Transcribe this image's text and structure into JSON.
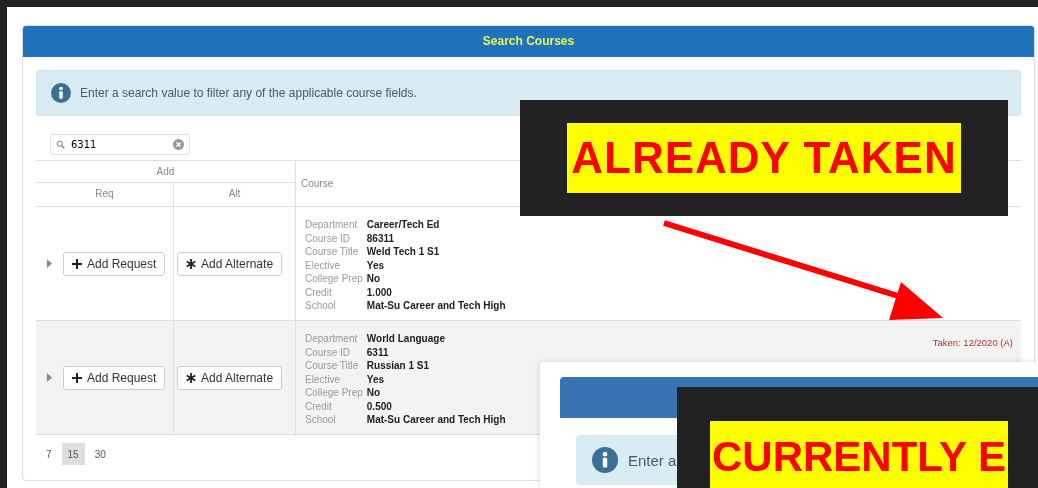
{
  "panel": {
    "title": "Search Courses",
    "info": "Enter a search value to filter any of the applicable course fields."
  },
  "search": {
    "value": "6311"
  },
  "table": {
    "group_header": "Add",
    "columns": [
      "Req",
      "Alt",
      "Course"
    ],
    "rows": [
      {
        "request_button": "Add Request",
        "alternate_button": "Add Alternate",
        "expanded": false,
        "fields": [
          {
            "label": "Department",
            "value": "Career/Tech Ed"
          },
          {
            "label": "Course ID",
            "value": "86311"
          },
          {
            "label": "Course Title",
            "value": "Weld Tech 1 S1"
          },
          {
            "label": "Elective",
            "value": "Yes"
          },
          {
            "label": "College Prep",
            "value": "No"
          },
          {
            "label": "Credit",
            "value": "1.000"
          },
          {
            "label": "School",
            "value": "Mat-Su Career and Tech High"
          }
        ]
      },
      {
        "request_button": "Add Request",
        "alternate_button": "Add Alternate",
        "expanded": false,
        "taken": "Taken: 12/2020 (A)",
        "fields": [
          {
            "label": "Department",
            "value": "World Language"
          },
          {
            "label": "Course ID",
            "value": "6311"
          },
          {
            "label": "Course Title",
            "value": "Russian 1 S1"
          },
          {
            "label": "Elective",
            "value": "Yes"
          },
          {
            "label": "College Prep",
            "value": "No"
          },
          {
            "label": "Credit",
            "value": "0.500"
          },
          {
            "label": "School",
            "value": "Mat-Su Career and Tech High"
          }
        ]
      }
    ]
  },
  "page_sizes": [
    {
      "label": "7",
      "selected": false
    },
    {
      "label": "15",
      "selected": true
    },
    {
      "label": "30",
      "selected": false
    }
  ],
  "annotations": [
    {
      "text": "ALREADY TAKEN"
    },
    {
      "text": "CURRENTLY E"
    }
  ],
  "second_window": {
    "info": "Enter a"
  }
}
